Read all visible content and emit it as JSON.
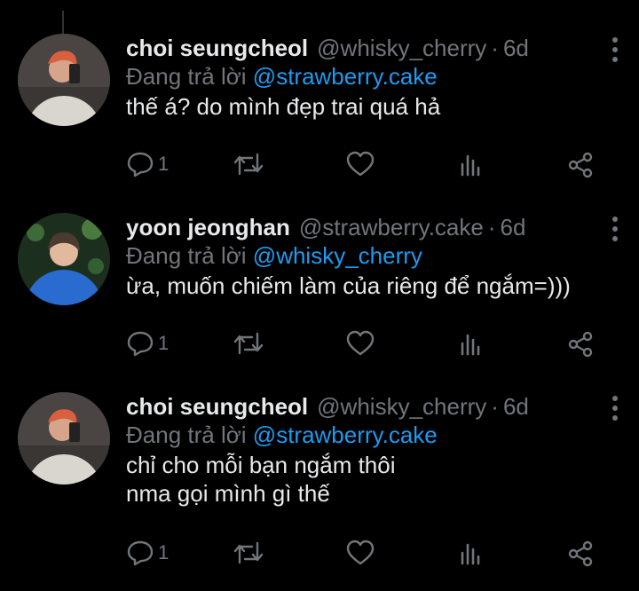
{
  "tweets": [
    {
      "name": "choi seungcheol",
      "handle": "@whisky_cherry",
      "dot": "·",
      "time": "6d",
      "reply_prefix": "Đang trả lời",
      "reply_to": "@strawberry.cake",
      "lines": [
        "thế á? do mình đẹp trai quá hả"
      ],
      "reply_count": "1"
    },
    {
      "name": "yoon jeonghan",
      "handle": "@strawberry.cake",
      "dot": "·",
      "time": "6d",
      "reply_prefix": "Đang trả lời",
      "reply_to": "@whisky_cherry",
      "lines": [
        "ừa, muốn chiếm làm của riêng để ngắm=)))"
      ],
      "reply_count": "1"
    },
    {
      "name": "choi seungcheol",
      "handle": "@whisky_cherry",
      "dot": "·",
      "time": "6d",
      "reply_prefix": "Đang trả lời",
      "reply_to": "@strawberry.cake",
      "lines": [
        "chỉ cho mỗi bạn ngắm thôi",
        "nma gọi mình gì thế"
      ],
      "reply_count": "1"
    }
  ],
  "colors": {
    "background": "#000000",
    "text": "#e7e9ea",
    "muted": "#71767b",
    "link": "#1d9bf0"
  },
  "icons": [
    "more-vertical-icon",
    "reply-icon",
    "retweet-icon",
    "like-icon",
    "views-icon",
    "share-icon"
  ]
}
